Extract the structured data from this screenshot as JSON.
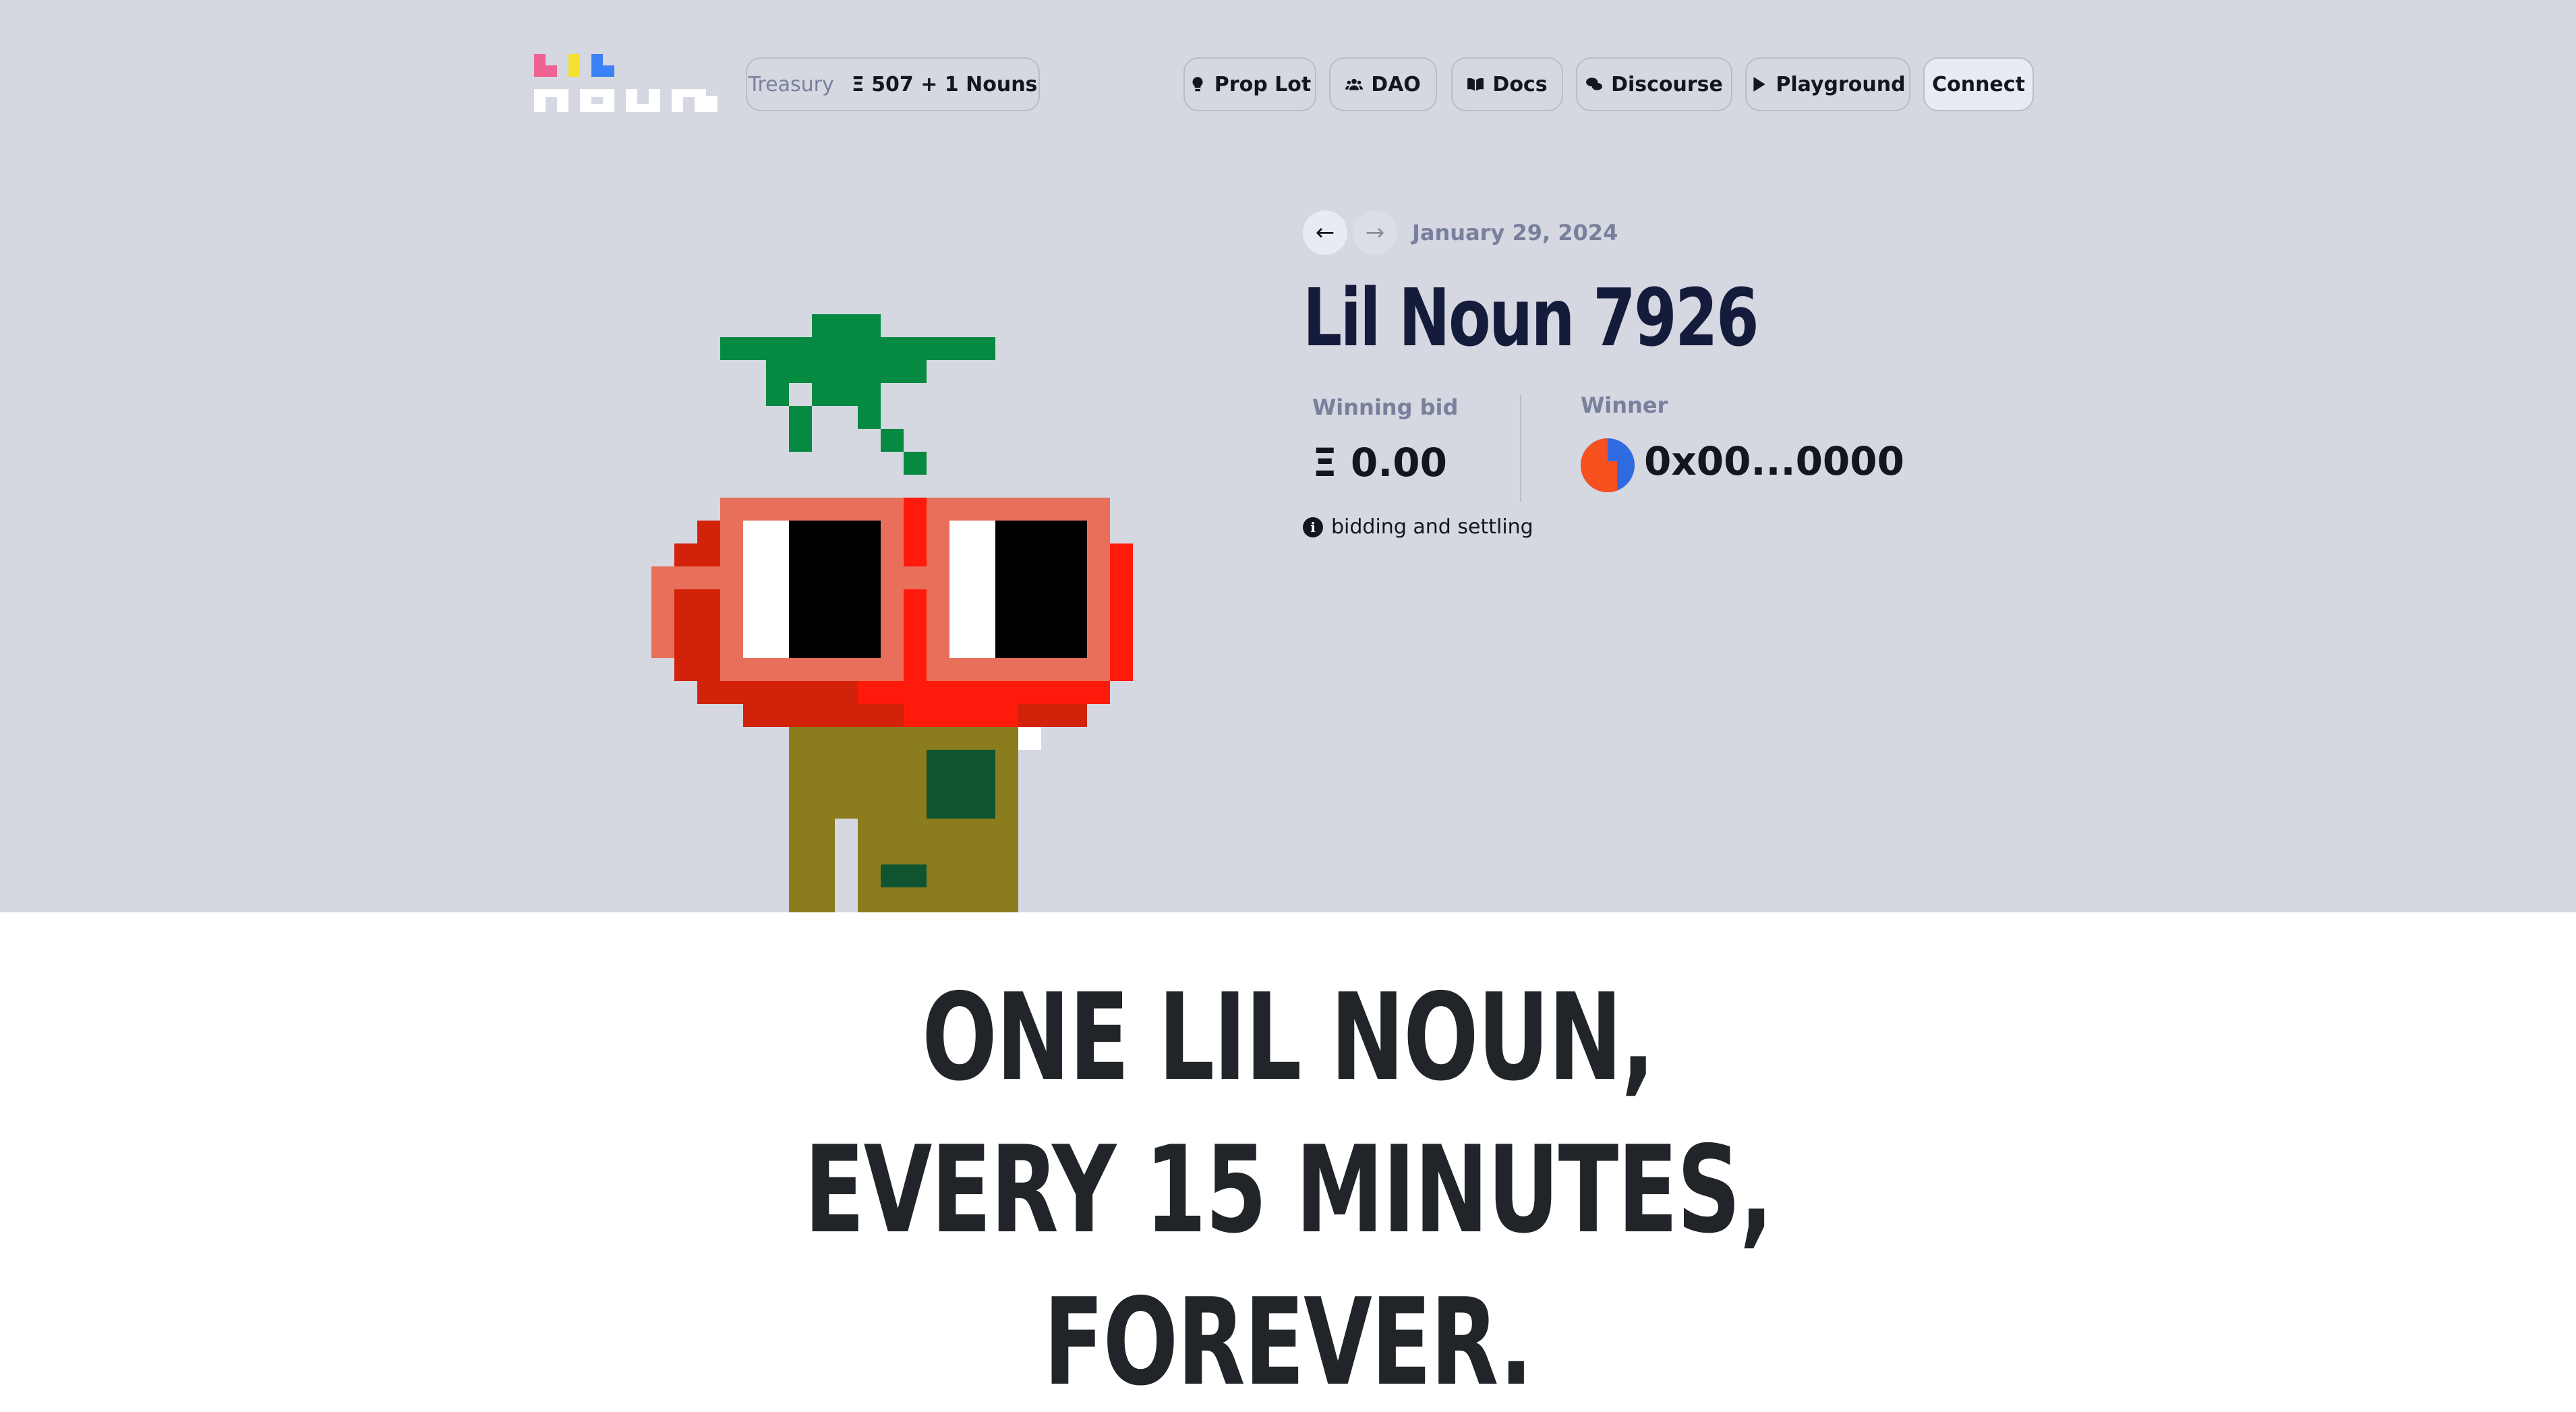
{
  "nav": {
    "treasury_label": "Treasury",
    "treasury_value": "Ξ 507 + 1 Nouns",
    "items": [
      {
        "label": "Prop Lot",
        "icon": "lightbulb-icon"
      },
      {
        "label": "DAO",
        "icon": "users-icon"
      },
      {
        "label": "Docs",
        "icon": "book-icon"
      },
      {
        "label": "Discourse",
        "icon": "comments-icon"
      },
      {
        "label": "Playground",
        "icon": "play-icon"
      }
    ],
    "connect_label": "Connect"
  },
  "auction": {
    "prev_arrow": "←",
    "next_arrow": "→",
    "date": "January 29, 2024",
    "title": "Lil Noun 7926",
    "winning_bid_label": "Winning bid",
    "winning_bid_value": "Ξ 0.00",
    "winner_label": "Winner",
    "winner_value": "0x00...0000",
    "info_icon": "i",
    "info_text": "bidding and settling"
  },
  "banner": {
    "line1": "ONE LIL NOUN,",
    "line2": "EVERY 15 MINUTES,",
    "line3": "FOREVER."
  },
  "colors": {
    "hero_background": "#d5d7e1",
    "title": "#151c3b",
    "muted": "#79809c"
  }
}
